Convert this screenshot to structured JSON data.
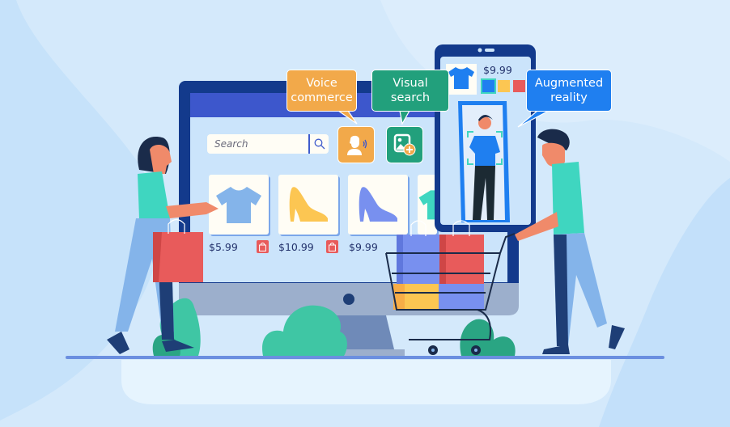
{
  "scene": {
    "description": "Flat illustration of modern e-commerce features: a desktop storefront, a phone with AR try-on, two shoppers with bags and a cart"
  },
  "callouts": {
    "voice_commerce": {
      "line1": "Voice",
      "line2": "commerce",
      "color": "#f2a94a",
      "icon": "voice-assistant-icon"
    },
    "visual_search": {
      "line1": "Visual",
      "line2": "search",
      "color": "#22a07c",
      "icon": "image-add-icon"
    },
    "augmented_reality": {
      "line1": "Augmented",
      "line2": "reality",
      "color": "#1f7ff0"
    }
  },
  "storefront": {
    "search": {
      "placeholder": "Search",
      "value": ""
    },
    "products": [
      {
        "name": "T-shirt",
        "price": "$5.99",
        "color": "#84b4ea",
        "icon": "tshirt-icon"
      },
      {
        "name": "High heel",
        "price": "$10.99",
        "color": "#fcc652",
        "icon": "high-heel-icon"
      },
      {
        "name": "High heel",
        "price": "$9.99",
        "color": "#7890ef",
        "icon": "high-heel-icon"
      },
      {
        "name": "T-shirt",
        "price": "",
        "color": "#3fd6c0",
        "icon": "tshirt-icon"
      }
    ]
  },
  "phone": {
    "product_price": "$9.99",
    "color_options": [
      "#1f7ff0",
      "#fcc652",
      "#e85b5b"
    ],
    "selected_color_index": 0
  },
  "colors": {
    "background": "#d4e9fb",
    "monitor_frame": "#133a8c",
    "monitor_header": "#3d57cc",
    "screen": "#cbe4fb",
    "accent_red": "#e85b5b",
    "accent_teal": "#3fd6c0",
    "ground_line": "#6b8fe0"
  }
}
